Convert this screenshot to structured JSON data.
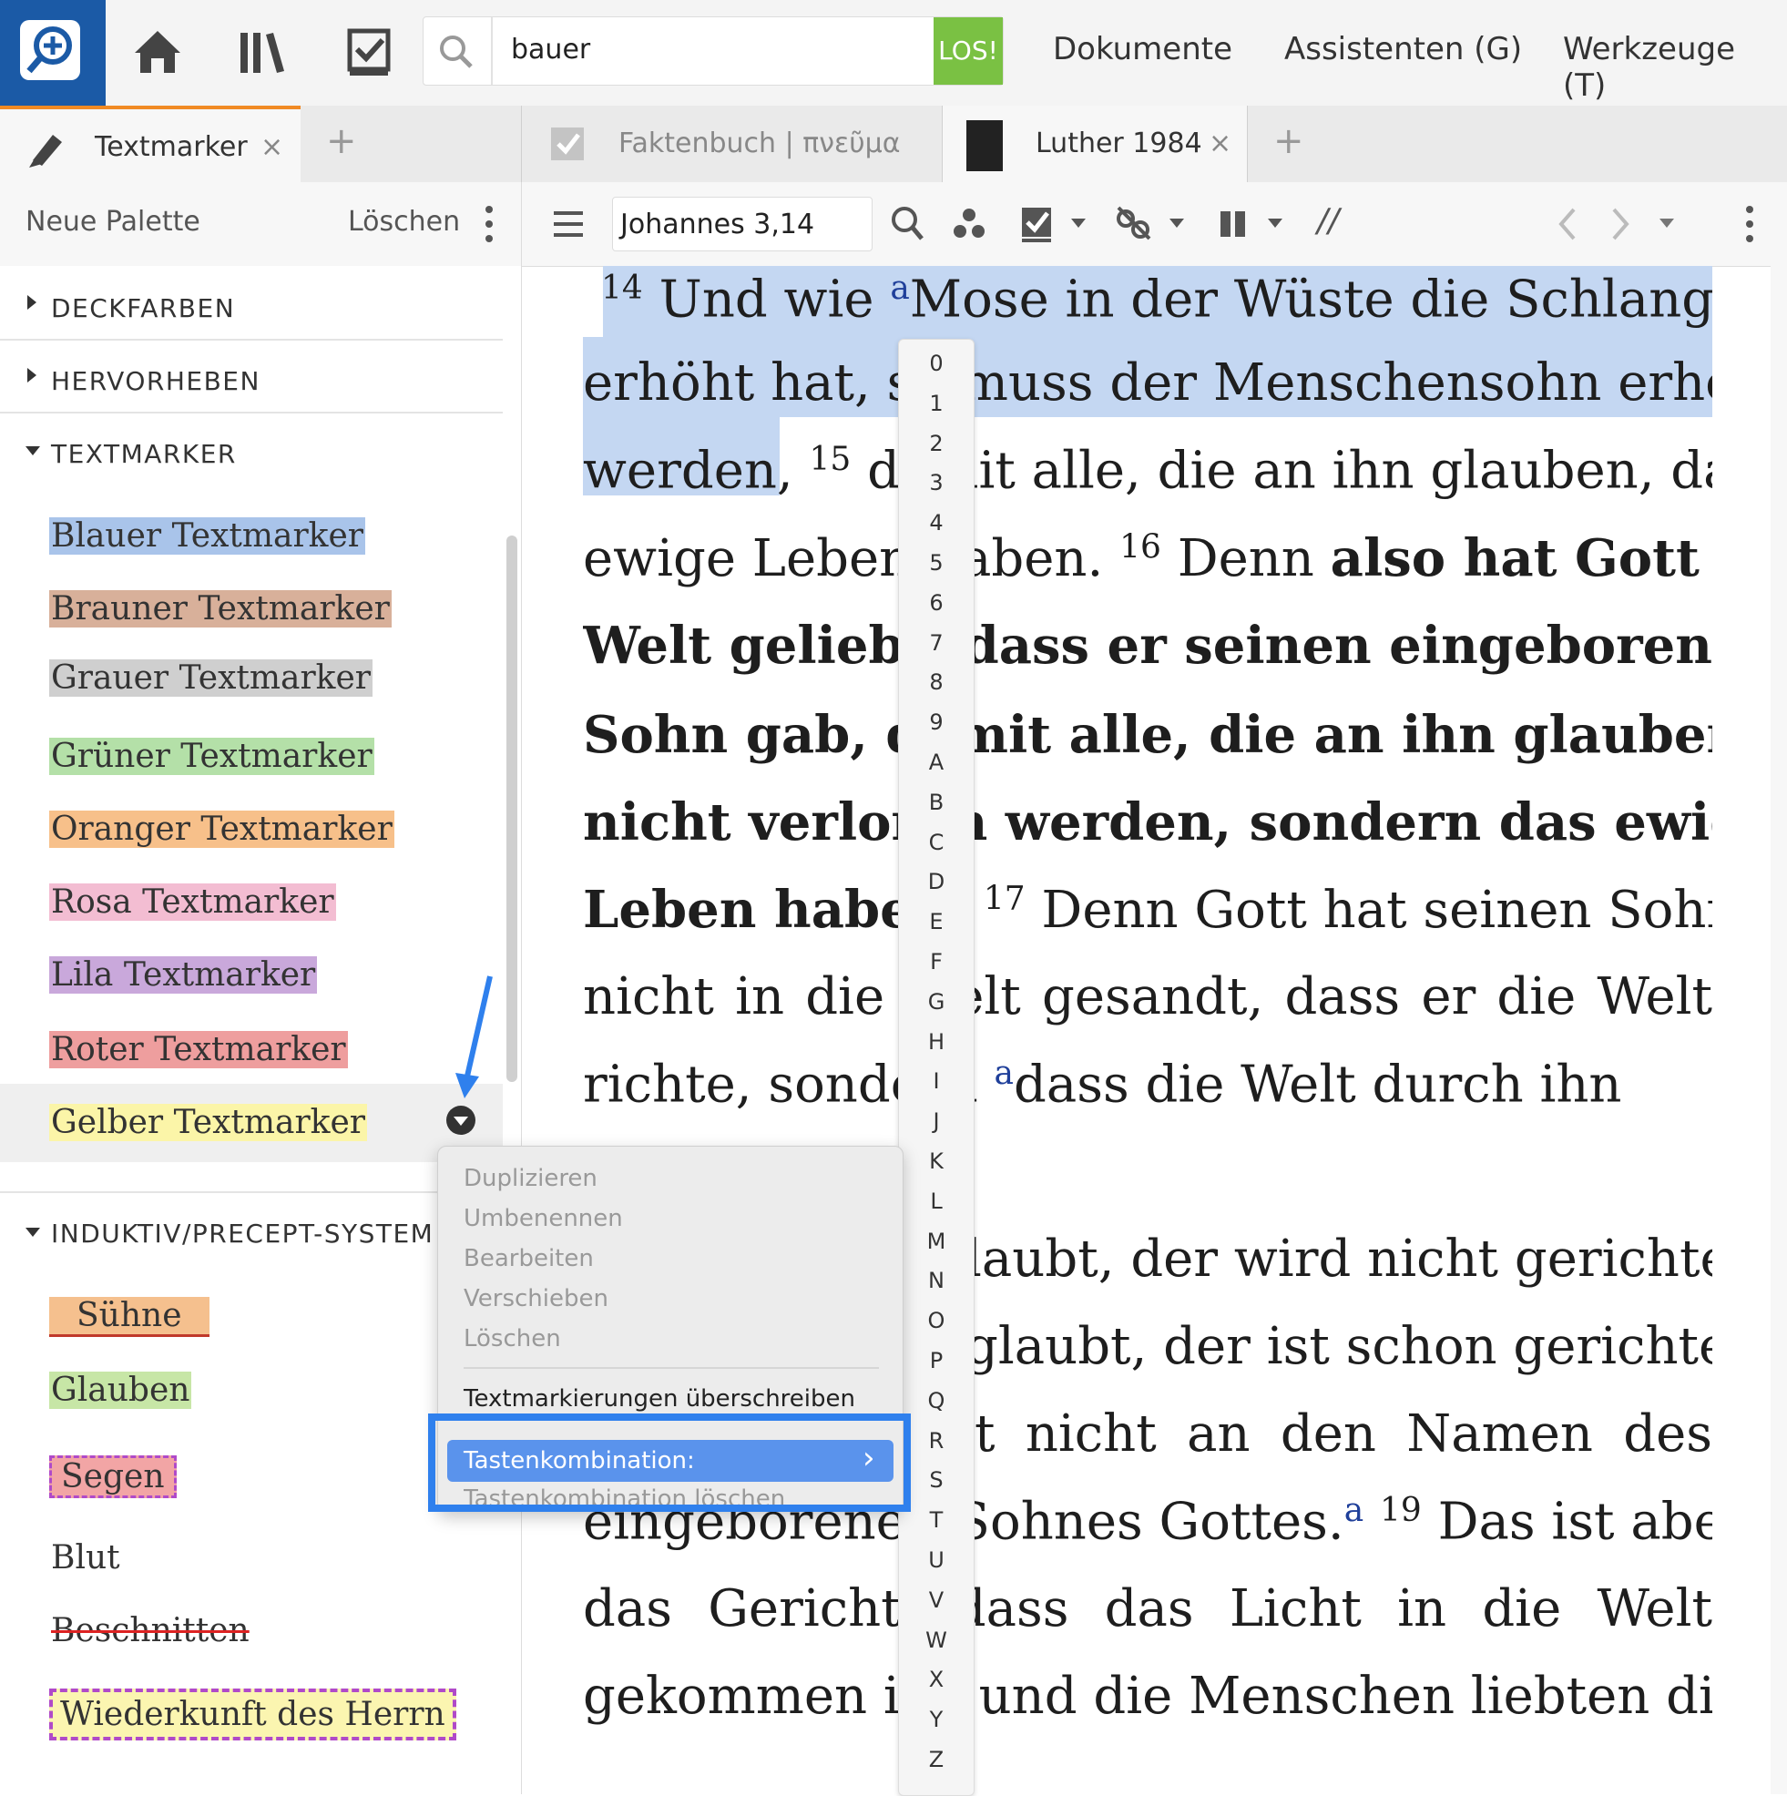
{
  "topbar": {
    "search_value": "bauer",
    "search_go": "LOS!",
    "menus": [
      "Dokumente",
      "Assistenten (G)",
      "Werkzeuge (T)"
    ],
    "icons": [
      "logos-bible-search-icon",
      "home-icon",
      "library-icon",
      "checklist-icon",
      "search-icon"
    ]
  },
  "tabs": {
    "left": {
      "label": "Textmarker",
      "close": "×"
    },
    "middle": {
      "label": "Faktenbuch | πνεῦμα"
    },
    "right": {
      "label": "Luther 1984",
      "close": "×"
    },
    "add": "+"
  },
  "left_toolbar": {
    "new_palette": "Neue Palette",
    "delete": "Löschen"
  },
  "bible_toolbar": {
    "reference": "Johannes 3,14",
    "parallel": "//"
  },
  "palette": {
    "sections": [
      "DECKFARBEN",
      "HERVORHEBEN",
      "TEXTMARKER",
      "INDUKTIV/PRECEPT-SYSTEM"
    ],
    "highlighters": [
      {
        "label": "Blauer Textmarker",
        "color": "#a9c4ea"
      },
      {
        "label": "Brauner Textmarker",
        "color": "#d8b09a"
      },
      {
        "label": "Grauer Textmarker",
        "color": "#cfcfcf"
      },
      {
        "label": "Grüner Textmarker",
        "color": "#b4e0a8"
      },
      {
        "label": "Oranger Textmarker",
        "color": "#f7c08a"
      },
      {
        "label": "Rosa Textmarker",
        "color": "#f3bdd2"
      },
      {
        "label": "Lila Textmarker",
        "color": "#c9a8db"
      },
      {
        "label": "Roter Textmarker",
        "color": "#ee9e9e"
      },
      {
        "label": "Gelber Textmarker",
        "color": "#fbf5a8"
      }
    ],
    "inductive": [
      {
        "label": "Sühne",
        "color": "#f5c08e"
      },
      {
        "label": "Glauben",
        "color": "#c7e6a6"
      },
      {
        "label": "Segen",
        "color": "#f2a5a5"
      },
      {
        "label": "Blut",
        "color": "#ffffff"
      },
      {
        "label": "Beschnitten",
        "color": "#ffffff"
      },
      {
        "label": "Wiederkunft des Herrn",
        "color": "#fbf5b0"
      }
    ]
  },
  "context_menu": {
    "items_disabled": [
      "Duplizieren",
      "Umbenennen",
      "Bearbeiten",
      "Verschieben",
      "Löschen"
    ],
    "overwrite": "Textmarkierungen überschreiben",
    "shortcut": "Tastenkombination:",
    "shortcut_clear": "Tastenkombination löschen",
    "submenu_arrow": "›"
  },
  "alphabet": [
    "0",
    "1",
    "2",
    "3",
    "4",
    "5",
    "6",
    "7",
    "8",
    "9",
    "A",
    "B",
    "C",
    "D",
    "E",
    "F",
    "G",
    "H",
    "I",
    "J",
    "K",
    "L",
    "M",
    "N",
    "O",
    "P",
    "Q",
    "R",
    "S",
    "T",
    "U",
    "V",
    "W",
    "X",
    "Y",
    "Z"
  ],
  "bible": {
    "v14": "14",
    "fn_a": "a",
    "l1": "Und wie ",
    "l1b": "Mose in der Wüste die Schlange",
    "l2": "erhöht hat, so muss der Menschensohn erhöht",
    "l3a": "werden,",
    "v15": "15",
    "l3b": " damit alle, die an ihn glauben, das",
    "l4a": "ewige Leben haben. ",
    "v16": "16",
    "l4b": " Denn ",
    "l4c": "also hat Gott die",
    "l5": "Welt geliebt, dass er seinen eingeborenen",
    "l6": "Sohn gab, damit alle, die an ihn glauben,",
    "l7": "nicht verloren werden, sondern das ewige",
    "l8a": "Leben haben.",
    "v17": "17",
    "l8b": " Denn Gott hat seinen Sohn",
    "l9": "nicht in die Welt gesandt, dass er die Welt",
    "l10a": "richte, sondern ",
    "l10b": "dass die Welt durch ihn",
    "l12": "laubt, der wird nicht gerichtet;",
    "l13": "glaubt, der ist schon gerichtet,",
    "l14": "t nicht an den Namen des",
    "l15a": "eingeborenen Sohnes Gottes.",
    "v19": "19",
    "l15b": " Das ist aber",
    "l16": "das Gericht, dass das Licht in die Welt",
    "l17": "gekommen ist, und die Menschen liebten die"
  }
}
